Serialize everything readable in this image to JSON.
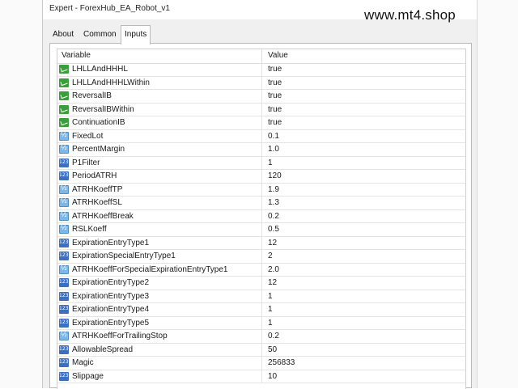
{
  "window": {
    "title": "Expert - ForexHub_EA_Robot_v1",
    "watermark": "www.mt4.shop"
  },
  "tabs": [
    {
      "label": "About",
      "active": false
    },
    {
      "label": "Common",
      "active": false
    },
    {
      "label": "Inputs",
      "active": true
    }
  ],
  "table": {
    "headers": {
      "variable": "Variable",
      "value": "Value"
    },
    "rows": [
      {
        "icon": "bool",
        "name": "LHLLAndHHHL",
        "value": "true"
      },
      {
        "icon": "bool",
        "name": "LHLLAndHHHLWithin",
        "value": "true"
      },
      {
        "icon": "bool",
        "name": "ReversalIB",
        "value": "true"
      },
      {
        "icon": "bool",
        "name": "ReversalIBWithin",
        "value": "true"
      },
      {
        "icon": "bool",
        "name": "ContinuationIB",
        "value": "true"
      },
      {
        "icon": "double",
        "name": "FixedLot",
        "value": "0.1"
      },
      {
        "icon": "double",
        "name": "PercentMargin",
        "value": "1.0"
      },
      {
        "icon": "int",
        "name": "P1Filter",
        "value": "1"
      },
      {
        "icon": "int",
        "name": "PeriodATRH",
        "value": "120"
      },
      {
        "icon": "double",
        "name": "ATRHKoeffTP",
        "value": "1.9"
      },
      {
        "icon": "double",
        "name": "ATRHKoeffSL",
        "value": "1.3"
      },
      {
        "icon": "double",
        "name": "ATRHKoeffBreak",
        "value": "0.2"
      },
      {
        "icon": "double",
        "name": "RSLKoeff",
        "value": "0.5"
      },
      {
        "icon": "int",
        "name": "ExpirationEntryType1",
        "value": "12"
      },
      {
        "icon": "int",
        "name": "ExpirationSpecialEntryType1",
        "value": "2"
      },
      {
        "icon": "double",
        "name": "ATRHKoeffForSpecialExpirationEntryType1",
        "value": "2.0"
      },
      {
        "icon": "int",
        "name": "ExpirationEntryType2",
        "value": "12"
      },
      {
        "icon": "int",
        "name": "ExpirationEntryType3",
        "value": "1"
      },
      {
        "icon": "int",
        "name": "ExpirationEntryType4",
        "value": "1"
      },
      {
        "icon": "int",
        "name": "ExpirationEntryType5",
        "value": "1"
      },
      {
        "icon": "double",
        "name": "ATRHKoeffForTrailingStop",
        "value": "0.2"
      },
      {
        "icon": "int",
        "name": "AllowableSpread",
        "value": "50"
      },
      {
        "icon": "int",
        "name": "Magic",
        "value": "256833"
      },
      {
        "icon": "int",
        "name": "Slippage",
        "value": "10"
      }
    ]
  }
}
